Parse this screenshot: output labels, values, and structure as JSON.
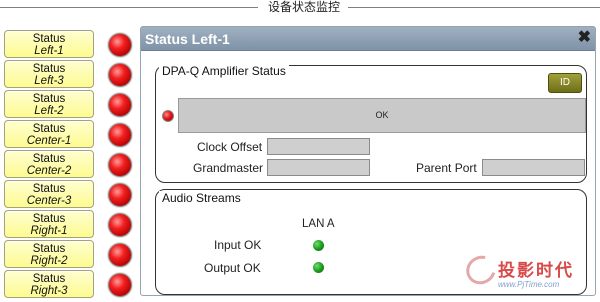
{
  "window": {
    "title": "设备状态监控"
  },
  "status_list": [
    {
      "line1": "Status",
      "line2": "Left-1"
    },
    {
      "line1": "Status",
      "line2": "Left-3"
    },
    {
      "line1": "Status",
      "line2": "Left-2"
    },
    {
      "line1": "Status",
      "line2": "Center-1"
    },
    {
      "line1": "Status",
      "line2": "Center-2"
    },
    {
      "line1": "Status",
      "line2": "Center-3"
    },
    {
      "line1": "Status",
      "line2": "Right-1"
    },
    {
      "line1": "Status",
      "line2": "Right-2"
    },
    {
      "line1": "Status",
      "line2": "Right-3"
    }
  ],
  "status_led_color": "#e32020",
  "panel": {
    "title": "Status Left-1",
    "close_icon": "close-icon",
    "amplifier": {
      "label": "DPA-Q Amplifier Status",
      "id_button": "ID",
      "status_text": "OK",
      "led_color": "#e32020",
      "clock_offset_label": "Clock Offset",
      "clock_offset_value": "",
      "grandmaster_label": "Grandmaster",
      "grandmaster_value": "",
      "parent_port_label": "Parent Port",
      "parent_port_value": ""
    },
    "audio": {
      "label": "Audio Streams",
      "column": "LAN A",
      "rows": [
        {
          "label": "Input OK",
          "led_color": "#1f9d1f"
        },
        {
          "label": "Output OK",
          "led_color": "#1f9d1f"
        }
      ]
    }
  },
  "watermark": {
    "text": "投影时代",
    "sub": "www.PjTime.com"
  }
}
